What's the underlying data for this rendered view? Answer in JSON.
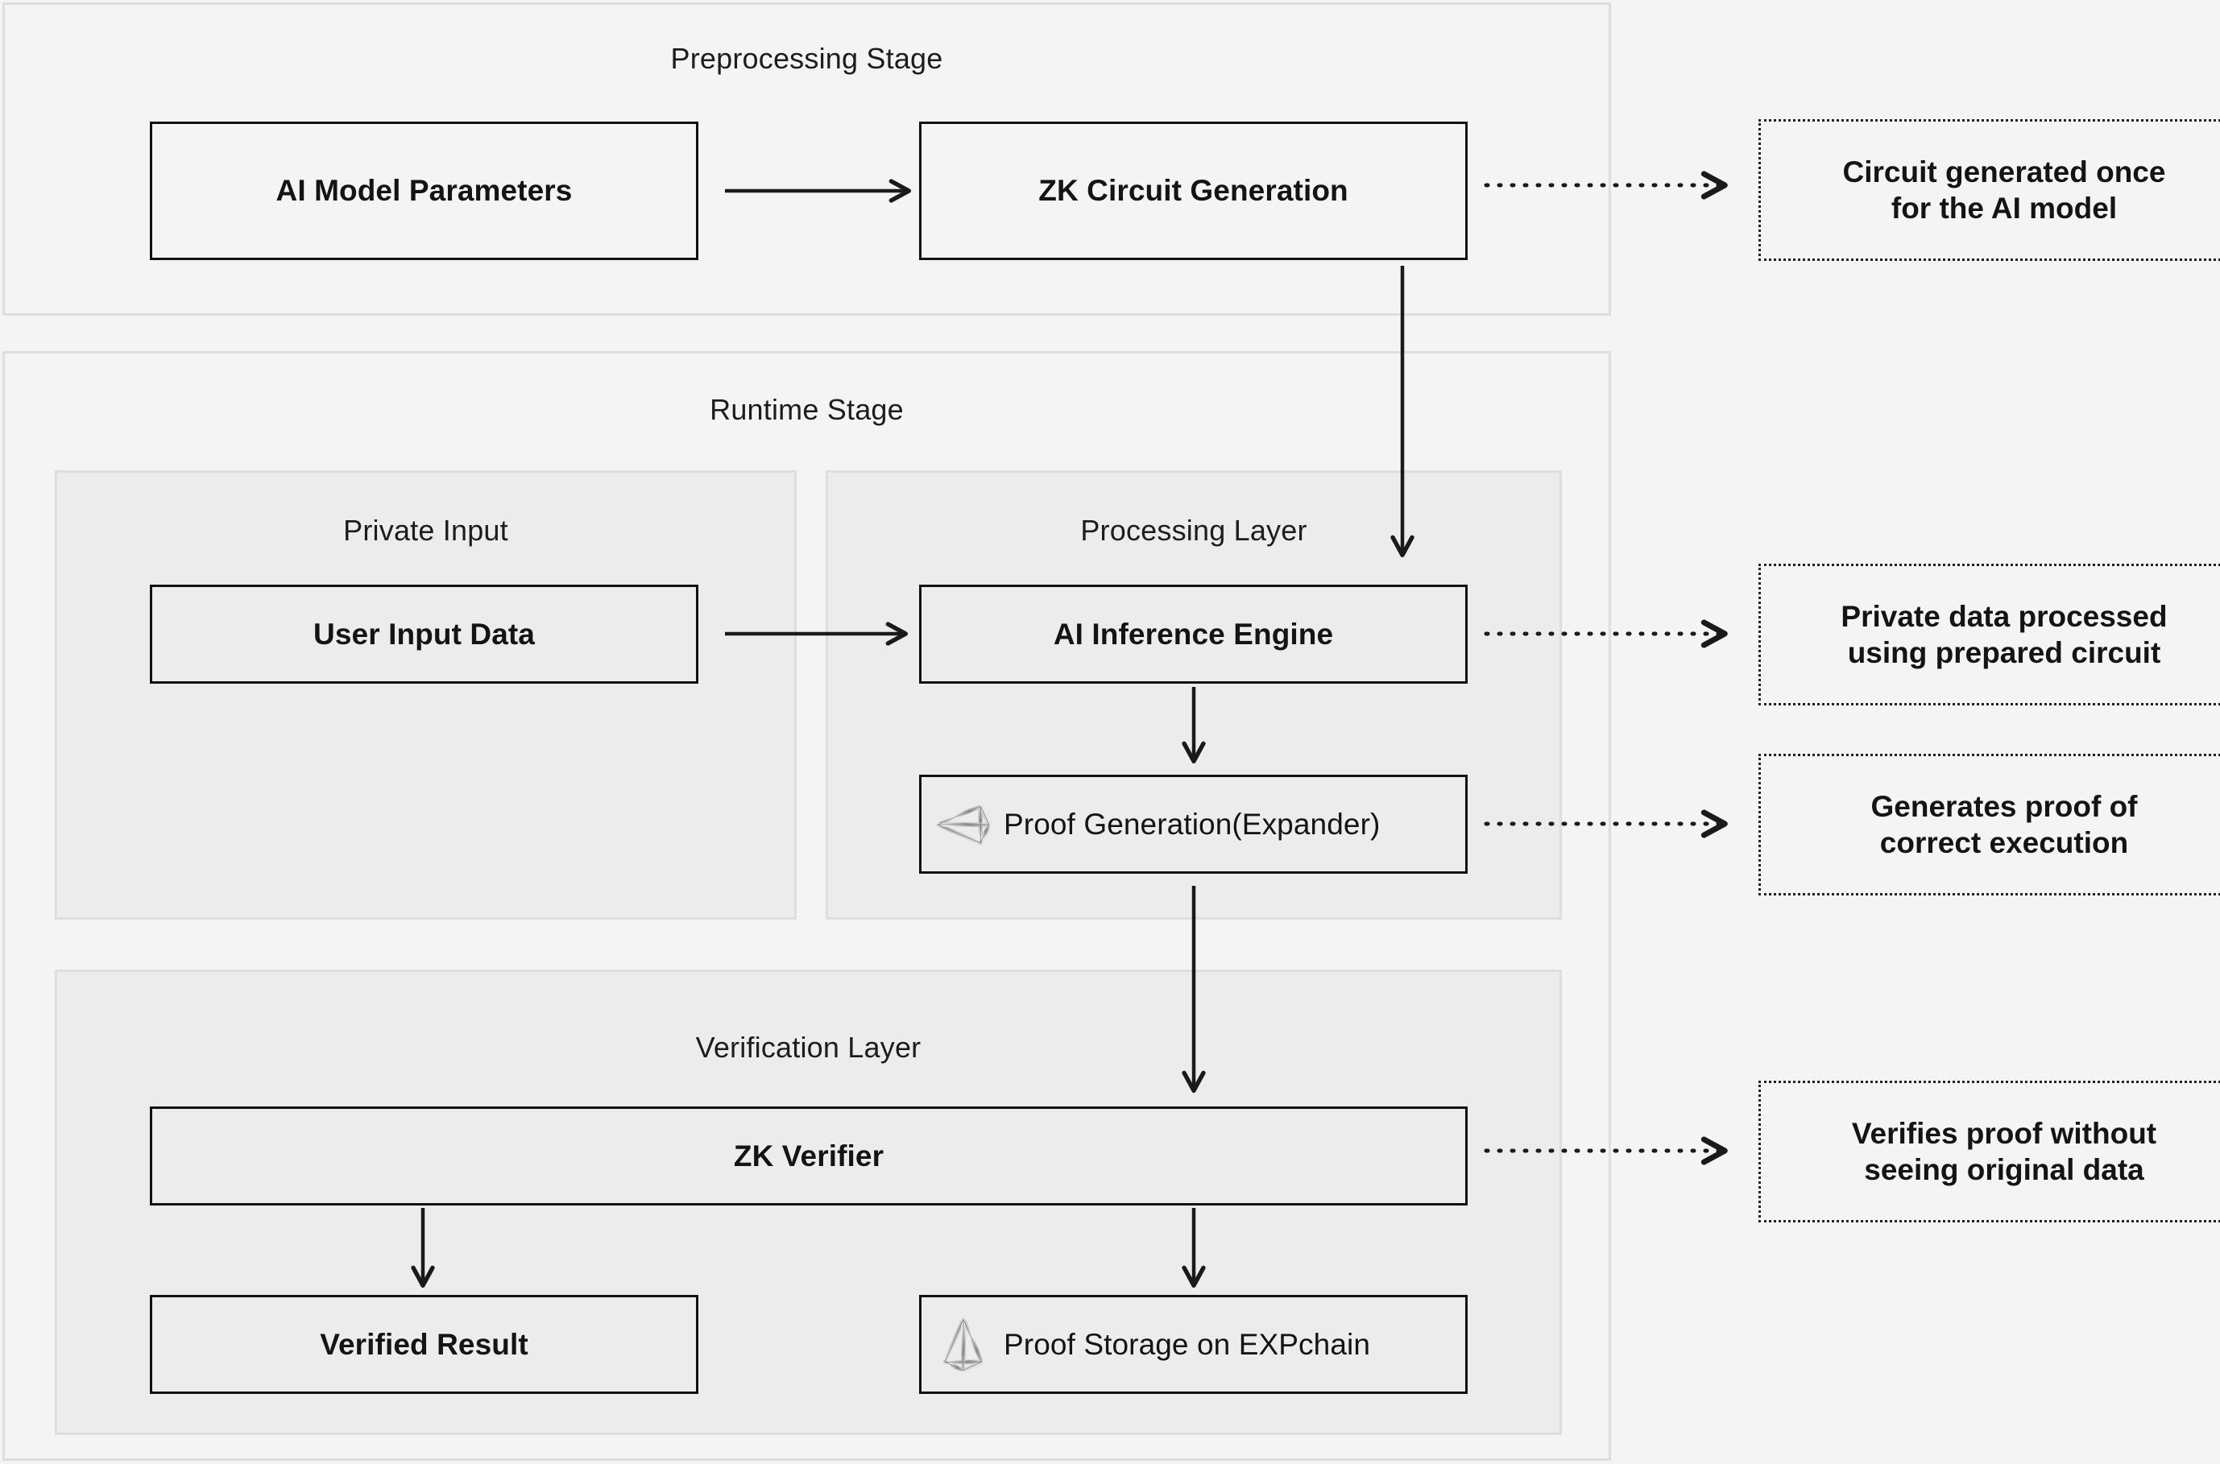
{
  "diagram": {
    "background": "#f4f4f4",
    "stage_fill": "#f4f4f4",
    "layer_fill": "#ececec",
    "border_color": "#dedede",
    "node_border": "#111111",
    "edge_color": "#222222"
  },
  "stages": {
    "preprocessing": {
      "title": "Preprocessing Stage"
    },
    "runtime": {
      "title": "Runtime Stage"
    }
  },
  "layers": {
    "private_input": {
      "title": "Private Input"
    },
    "processing": {
      "title": "Processing Layer"
    },
    "verification": {
      "title": "Verification Layer"
    }
  },
  "nodes": {
    "ai_model_parameters": {
      "label": "AI Model Parameters"
    },
    "zk_circuit_generation": {
      "label": "ZK Circuit Generation"
    },
    "user_input_data": {
      "label": "User Input Data"
    },
    "ai_inference_engine": {
      "label": "AI Inference Engine"
    },
    "proof_generation": {
      "label": "Proof Generation(Expander)",
      "icon": "wireframe-diamond-icon"
    },
    "zk_verifier": {
      "label": "ZK Verifier"
    },
    "verified_result": {
      "label": "Verified Result"
    },
    "proof_storage": {
      "label": "Proof Storage on EXPchain",
      "icon": "wireframe-pyramid-icon"
    }
  },
  "notes": {
    "circuit_once": {
      "line1": "Circuit generated once",
      "line2": "for the AI model"
    },
    "private_processed": {
      "line1": "Private data processed",
      "line2": "using prepared circuit"
    },
    "generates_proof": {
      "line1": "Generates proof of",
      "line2": "correct execution"
    },
    "verifies_proof": {
      "line1": "Verifies proof without",
      "line2": "seeing original data"
    }
  }
}
